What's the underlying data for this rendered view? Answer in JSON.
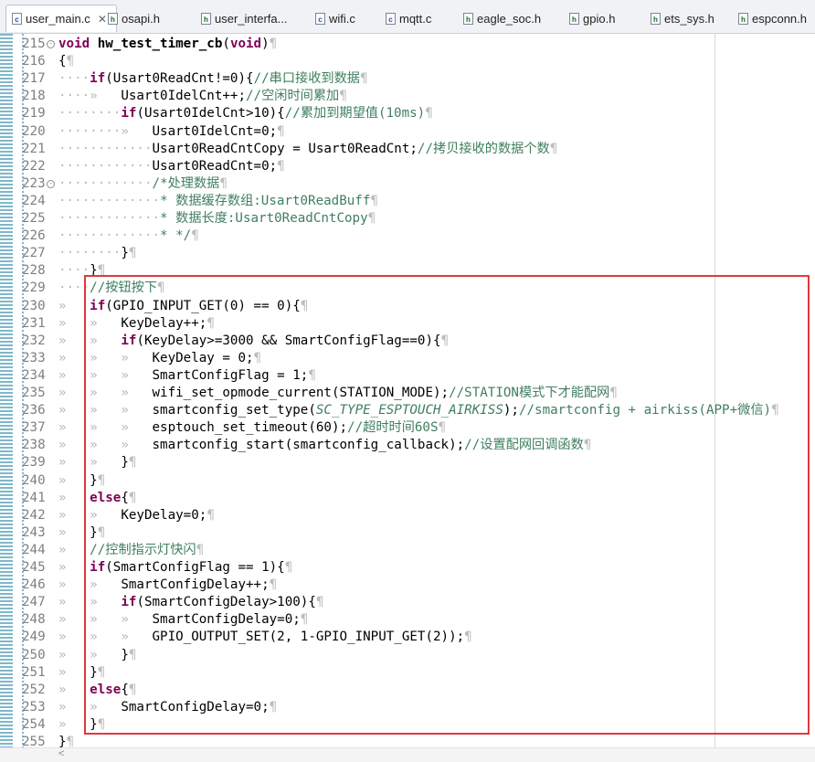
{
  "tabs": [
    {
      "label": "user_main.c",
      "icon": "c-file-icon",
      "active": true
    },
    {
      "label": "osapi.h",
      "icon": "h-file-icon"
    },
    {
      "label": "user_interfa...",
      "icon": "h-file-icon"
    },
    {
      "label": "wifi.c",
      "icon": "c-file-icon"
    },
    {
      "label": "mqtt.c",
      "icon": "c-file-icon"
    },
    {
      "label": "eagle_soc.h",
      "icon": "h-file-icon"
    },
    {
      "label": "gpio.h",
      "icon": "h-file-icon"
    },
    {
      "label": "ets_sys.h",
      "icon": "h-file-icon"
    },
    {
      "label": "espconn.h",
      "icon": "h-file-icon"
    }
  ],
  "editor": {
    "lines": [
      {
        "n": "215",
        "fold": "⊖",
        "seg": [
          [
            "kw",
            "void"
          ],
          [
            "",
            " "
          ],
          [
            "b",
            "hw_test_timer_cb"
          ],
          [
            "",
            "("
          ],
          [
            "kw",
            "void"
          ],
          [
            "",
            ")"
          ],
          [
            "pil",
            "¶"
          ]
        ]
      },
      {
        "n": "216",
        "seg": [
          [
            "",
            "{"
          ],
          [
            "pil",
            "¶"
          ]
        ]
      },
      {
        "n": "217",
        "seg": [
          [
            "ws",
            "····"
          ],
          [
            "kw",
            "if"
          ],
          [
            "",
            "(Usart0ReadCnt!=0){"
          ],
          [
            "cm",
            "//串口接收到数据"
          ],
          [
            "pil",
            "¶"
          ]
        ]
      },
      {
        "n": "218",
        "seg": [
          [
            "ws",
            "····»   "
          ],
          [
            "",
            "Usart0IdelCnt++;"
          ],
          [
            "cm",
            "//空闲时间累加"
          ],
          [
            "pil",
            "¶"
          ]
        ]
      },
      {
        "n": "219",
        "seg": [
          [
            "ws",
            "········"
          ],
          [
            "kw",
            "if"
          ],
          [
            "",
            "(Usart0IdelCnt>10){"
          ],
          [
            "cm",
            "//累加到期望值(10ms)"
          ],
          [
            "pil",
            "¶"
          ]
        ]
      },
      {
        "n": "220",
        "seg": [
          [
            "ws",
            "········»   "
          ],
          [
            "",
            "Usart0IdelCnt=0;"
          ],
          [
            "pil",
            "¶"
          ]
        ]
      },
      {
        "n": "221",
        "seg": [
          [
            "ws",
            "············"
          ],
          [
            "",
            "Usart0ReadCntCopy = Usart0ReadCnt;"
          ],
          [
            "cm",
            "//拷贝接收的数据个数"
          ],
          [
            "pil",
            "¶"
          ]
        ]
      },
      {
        "n": "222",
        "seg": [
          [
            "ws",
            "············"
          ],
          [
            "",
            "Usart0ReadCnt=0;"
          ],
          [
            "pil",
            "¶"
          ]
        ]
      },
      {
        "n": "223",
        "fold": "⊖",
        "seg": [
          [
            "ws",
            "············"
          ],
          [
            "cm",
            "/*处理数据"
          ],
          [
            "pil",
            "¶"
          ]
        ]
      },
      {
        "n": "224",
        "seg": [
          [
            "ws",
            "·············"
          ],
          [
            "cm",
            "* 数据缓存数组:Usart0ReadBuff"
          ],
          [
            "pil",
            "¶"
          ]
        ]
      },
      {
        "n": "225",
        "seg": [
          [
            "ws",
            "·············"
          ],
          [
            "cm",
            "* 数据长度:Usart0ReadCntCopy"
          ],
          [
            "pil",
            "¶"
          ]
        ]
      },
      {
        "n": "226",
        "seg": [
          [
            "ws",
            "·············"
          ],
          [
            "cm",
            "* */"
          ],
          [
            "pil",
            "¶"
          ]
        ]
      },
      {
        "n": "227",
        "seg": [
          [
            "ws",
            "········"
          ],
          [
            "",
            "}"
          ],
          [
            "pil",
            "¶"
          ]
        ]
      },
      {
        "n": "228",
        "seg": [
          [
            "ws",
            "····"
          ],
          [
            "",
            "}"
          ],
          [
            "pil",
            "¶"
          ]
        ]
      },
      {
        "n": "229",
        "seg": [
          [
            "ws",
            "····"
          ],
          [
            "cm",
            "//按钮按下"
          ],
          [
            "pil",
            "¶"
          ]
        ]
      },
      {
        "n": "230",
        "seg": [
          [
            "ws",
            "»   "
          ],
          [
            "kw",
            "if"
          ],
          [
            "",
            "(GPIO_INPUT_GET(0) == 0){"
          ],
          [
            "pil",
            "¶"
          ]
        ]
      },
      {
        "n": "231",
        "seg": [
          [
            "ws",
            "»   »   "
          ],
          [
            "",
            "KeyDelay++;"
          ],
          [
            "pil",
            "¶"
          ]
        ]
      },
      {
        "n": "232",
        "seg": [
          [
            "ws",
            "»   »   "
          ],
          [
            "kw",
            "if"
          ],
          [
            "",
            "(KeyDelay>=3000 && SmartConfigFlag==0){"
          ],
          [
            "pil",
            "¶"
          ]
        ]
      },
      {
        "n": "233",
        "seg": [
          [
            "ws",
            "»   »   »   "
          ],
          [
            "",
            "KeyDelay = 0;"
          ],
          [
            "pil",
            "¶"
          ]
        ]
      },
      {
        "n": "234",
        "seg": [
          [
            "ws",
            "»   »   »   "
          ],
          [
            "",
            "SmartConfigFlag = 1;"
          ],
          [
            "pil",
            "¶"
          ]
        ]
      },
      {
        "n": "235",
        "seg": [
          [
            "ws",
            "»   »   »   "
          ],
          [
            "",
            "wifi_set_opmode_current(STATION_MODE);"
          ],
          [
            "cm",
            "//STATION模式下才能配网"
          ],
          [
            "pil",
            "¶"
          ]
        ]
      },
      {
        "n": "236",
        "seg": [
          [
            "ws",
            "»   »   »   "
          ],
          [
            "",
            "smartconfig_set_type("
          ],
          [
            "mc",
            "SC_TYPE_ESPTOUCH_AIRKISS"
          ],
          [
            "",
            ");"
          ],
          [
            "cm",
            "//smartconfig + airkiss(APP+微信)"
          ],
          [
            "pil",
            "¶"
          ]
        ]
      },
      {
        "n": "237",
        "seg": [
          [
            "ws",
            "»   »   »   "
          ],
          [
            "",
            "esptouch_set_timeout(60);"
          ],
          [
            "cm",
            "//超时时间60S"
          ],
          [
            "pil",
            "¶"
          ]
        ]
      },
      {
        "n": "238",
        "seg": [
          [
            "ws",
            "»   »   »   "
          ],
          [
            "",
            "smartconfig_start(smartconfig_callback);"
          ],
          [
            "cm",
            "//设置配网回调函数"
          ],
          [
            "pil",
            "¶"
          ]
        ]
      },
      {
        "n": "239",
        "seg": [
          [
            "ws",
            "»   »   "
          ],
          [
            "",
            "}"
          ],
          [
            "pil",
            "¶"
          ]
        ]
      },
      {
        "n": "240",
        "seg": [
          [
            "ws",
            "»   "
          ],
          [
            "",
            "}"
          ],
          [
            "pil",
            "¶"
          ]
        ]
      },
      {
        "n": "241",
        "seg": [
          [
            "ws",
            "»   "
          ],
          [
            "kw",
            "else"
          ],
          [
            "",
            "{"
          ],
          [
            "pil",
            "¶"
          ]
        ]
      },
      {
        "n": "242",
        "seg": [
          [
            "ws",
            "»   »   "
          ],
          [
            "",
            "KeyDelay=0;"
          ],
          [
            "pil",
            "¶"
          ]
        ]
      },
      {
        "n": "243",
        "seg": [
          [
            "ws",
            "»   "
          ],
          [
            "",
            "}"
          ],
          [
            "pil",
            "¶"
          ]
        ]
      },
      {
        "n": "244",
        "seg": [
          [
            "ws",
            "»   "
          ],
          [
            "cm",
            "//控制指示灯快闪"
          ],
          [
            "pil",
            "¶"
          ]
        ]
      },
      {
        "n": "245",
        "seg": [
          [
            "ws",
            "»   "
          ],
          [
            "kw",
            "if"
          ],
          [
            "",
            "(SmartConfigFlag == 1){"
          ],
          [
            "pil",
            "¶"
          ]
        ]
      },
      {
        "n": "246",
        "seg": [
          [
            "ws",
            "»   »   "
          ],
          [
            "",
            "SmartConfigDelay++;"
          ],
          [
            "pil",
            "¶"
          ]
        ]
      },
      {
        "n": "247",
        "seg": [
          [
            "ws",
            "»   »   "
          ],
          [
            "kw",
            "if"
          ],
          [
            "",
            "(SmartConfigDelay>100){"
          ],
          [
            "pil",
            "¶"
          ]
        ]
      },
      {
        "n": "248",
        "seg": [
          [
            "ws",
            "»   »   »   "
          ],
          [
            "",
            "SmartConfigDelay=0;"
          ],
          [
            "pil",
            "¶"
          ]
        ]
      },
      {
        "n": "249",
        "seg": [
          [
            "ws",
            "»   »   »   "
          ],
          [
            "",
            "GPIO_OUTPUT_SET(2, 1-GPIO_INPUT_GET(2));"
          ],
          [
            "pil",
            "¶"
          ]
        ]
      },
      {
        "n": "250",
        "seg": [
          [
            "ws",
            "»   »   "
          ],
          [
            "",
            "}"
          ],
          [
            "pil",
            "¶"
          ]
        ]
      },
      {
        "n": "251",
        "seg": [
          [
            "ws",
            "»   "
          ],
          [
            "",
            "}"
          ],
          [
            "pil",
            "¶"
          ]
        ]
      },
      {
        "n": "252",
        "seg": [
          [
            "ws",
            "»   "
          ],
          [
            "kw",
            "else"
          ],
          [
            "",
            "{"
          ],
          [
            "pil",
            "¶"
          ]
        ]
      },
      {
        "n": "253",
        "seg": [
          [
            "ws",
            "»   »   "
          ],
          [
            "",
            "SmartConfigDelay=0;"
          ],
          [
            "pil",
            "¶"
          ]
        ]
      },
      {
        "n": "254",
        "seg": [
          [
            "ws",
            "»   "
          ],
          [
            "",
            "}"
          ],
          [
            "pil",
            "¶"
          ]
        ]
      },
      {
        "n": "255",
        "seg": [
          [
            "",
            "}"
          ],
          [
            "pil",
            "¶"
          ]
        ]
      }
    ]
  },
  "scroll_marker": "<",
  "colors": {
    "keyword": "#7f0055",
    "comment": "#3f7f5f",
    "highlight_box": "#e0393e",
    "line_number": "#7f7f7f"
  }
}
